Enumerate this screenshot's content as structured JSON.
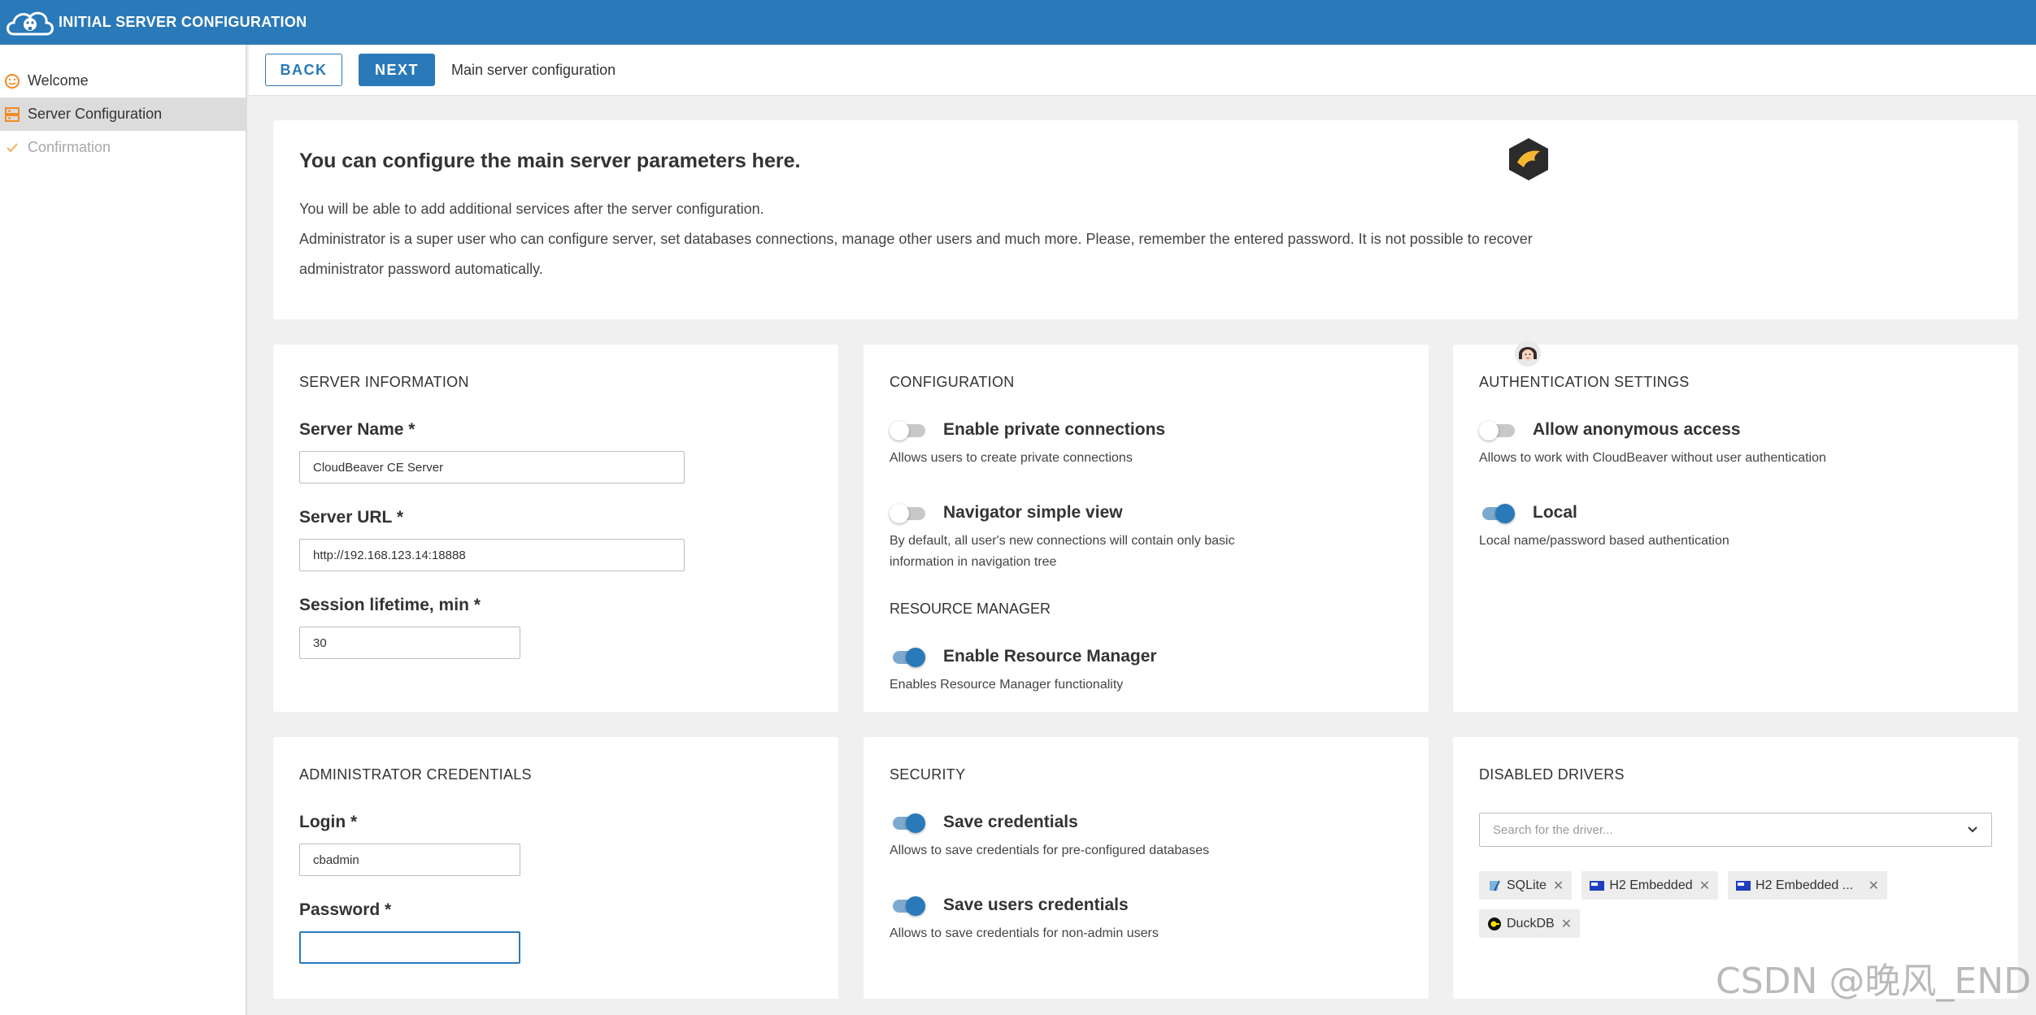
{
  "app": {
    "title": "INITIAL SERVER CONFIGURATION"
  },
  "sidebar": {
    "items": [
      {
        "label": "Welcome"
      },
      {
        "label": "Server Configuration"
      },
      {
        "label": "Confirmation"
      }
    ]
  },
  "toolbar": {
    "back_label": "BACK",
    "next_label": "NEXT",
    "page_label": "Main server configuration"
  },
  "intro": {
    "heading": "You can configure the main server parameters here.",
    "line1": "You will be able to add additional services after the server configuration.",
    "line2": "Administrator is a super user who can configure server, set databases connections, manage other users and much more. Please, remember the entered password. It is not possible to recover administrator password automatically."
  },
  "server_info": {
    "title": "SERVER INFORMATION",
    "name_label": "Server Name *",
    "name_value": "CloudBeaver CE Server",
    "url_label": "Server URL *",
    "url_value": "http://192.168.123.14:18888",
    "session_label": "Session lifetime, min *",
    "session_value": "30"
  },
  "configuration": {
    "title": "CONFIGURATION",
    "private_label": "Enable private connections",
    "private_desc": "Allows users to create private connections",
    "private_on": false,
    "navigator_label": "Navigator simple view",
    "navigator_desc": "By default, all user's new connections will contain only basic information in navigation tree",
    "navigator_on": false,
    "resource_title": "RESOURCE MANAGER",
    "resource_label": "Enable Resource Manager",
    "resource_desc": "Enables Resource Manager functionality",
    "resource_on": true
  },
  "auth": {
    "title": "AUTHENTICATION SETTINGS",
    "anon_label": "Allow anonymous access",
    "anon_desc": "Allows to work with CloudBeaver without user authentication",
    "anon_on": false,
    "local_label": "Local",
    "local_desc": "Local name/password based authentication",
    "local_on": true
  },
  "admin": {
    "title": "ADMINISTRATOR CREDENTIALS",
    "login_label": "Login *",
    "login_value": "cbadmin",
    "password_label": "Password *",
    "password_value": ""
  },
  "security": {
    "title": "SECURITY",
    "save_label": "Save credentials",
    "save_desc": "Allows to save credentials for pre-configured databases",
    "save_on": true,
    "users_label": "Save users credentials",
    "users_desc": "Allows to save credentials for non-admin users",
    "users_on": true
  },
  "drivers": {
    "title": "DISABLED DRIVERS",
    "search_placeholder": "Search for the driver...",
    "chips": [
      {
        "label": "SQLite",
        "icon": "sqlite-icon"
      },
      {
        "label": "H2 Embedded",
        "icon": "h2-icon"
      },
      {
        "label": "H2 Embedded ...",
        "icon": "h2-icon"
      },
      {
        "label": "DuckDB",
        "icon": "duckdb-icon"
      }
    ]
  },
  "watermark": "CSDN @晚风_END",
  "colors": {
    "brand": "#2a79b9",
    "accent_orange": "#f08a24"
  }
}
